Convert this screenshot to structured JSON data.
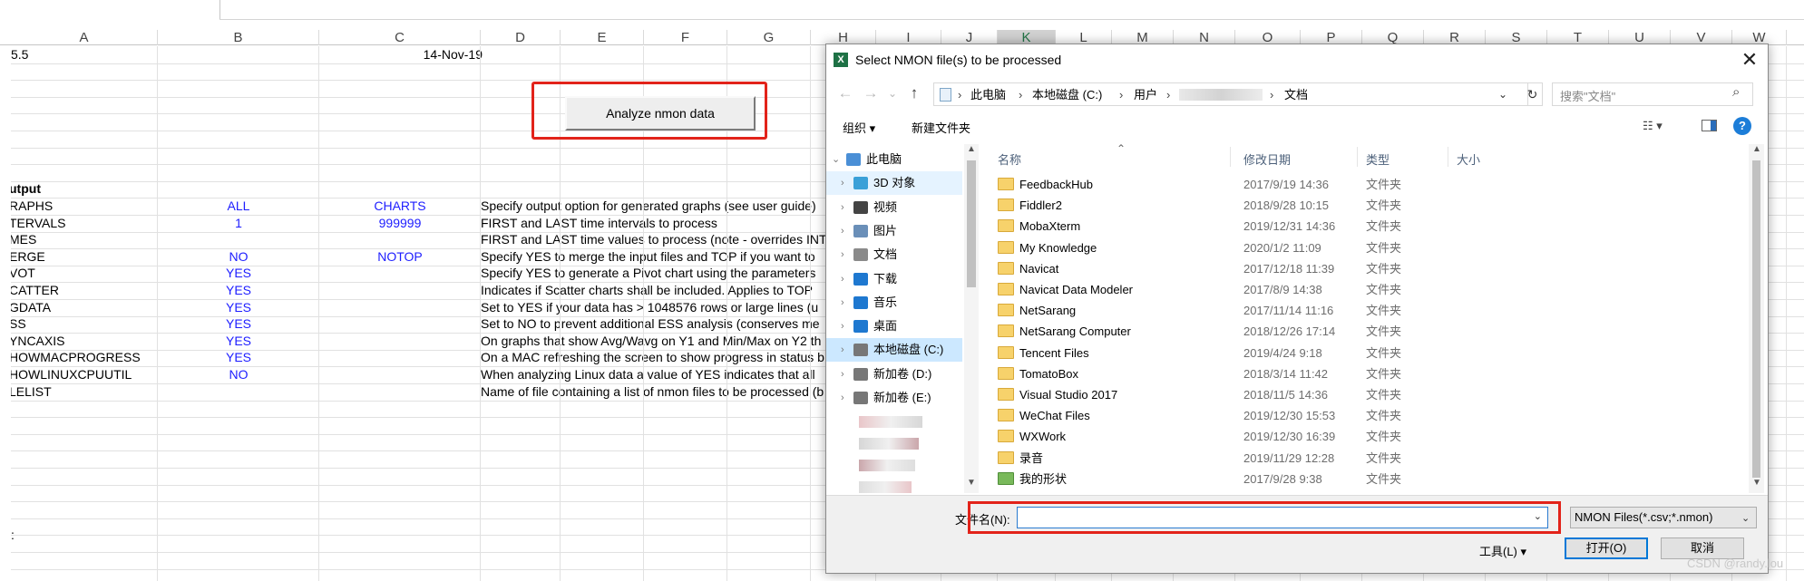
{
  "columns": [
    "A",
    "B",
    "C",
    "D",
    "E",
    "F",
    "G",
    "H",
    "I",
    "J",
    "K",
    "L",
    "M",
    "N",
    "O",
    "P",
    "Q",
    "R",
    "S",
    "T",
    "U",
    "V",
    "W"
  ],
  "active_column": "K",
  "sheet": {
    "row1": {
      "a": "5.5",
      "c": "14-Nov-19"
    },
    "section_label": "utput",
    "rows": [
      {
        "a": "RAPHS",
        "b": "ALL",
        "c": "CHARTS",
        "d": "Specify output option for generated graphs (see user guide)"
      },
      {
        "a": "TERVALS",
        "b": "1",
        "c": "999999",
        "d": "FIRST and LAST time intervals to process"
      },
      {
        "a": "MES",
        "b": "",
        "c": "",
        "d": "FIRST and LAST time values to process (note - overrides INT"
      },
      {
        "a": "ERGE",
        "b": "NO",
        "c": "NOTOP",
        "d": "Specify YES to merge the input files and TOP if you want to"
      },
      {
        "a": "VOT",
        "b": "YES",
        "c": "",
        "d": "Specify YES to generate a Pivot chart using the parameters"
      },
      {
        "a": "CATTER",
        "b": "YES",
        "c": "",
        "d": "Indicates if Scatter charts shall be included.  Applies to TOP"
      },
      {
        "a": "GDATA",
        "b": "YES",
        "c": "",
        "d": "Set to YES if your data has > 1048576 rows or large lines (u"
      },
      {
        "a": "SS",
        "b": "YES",
        "c": "",
        "d": "Set to NO to prevent additional ESS analysis (conserves me"
      },
      {
        "a": "YNCAXIS",
        "b": "YES",
        "c": "",
        "d": "On graphs that show Avg/Wavg on Y1 and Min/Max on Y2 th"
      },
      {
        "a": "HOWMACPROGRESS",
        "b": "YES",
        "c": "",
        "d": "On a MAC refreshing the screen to show progress in status b"
      },
      {
        "a": "HOWLINUXCPUUTIL",
        "b": "NO",
        "c": "",
        "d": "When analyzing Linux data a value of YES indicates that all"
      },
      {
        "a": "LELIST",
        "b": "",
        "c": "",
        "d": "Name of file containing a list of nmon files to be processed (b"
      }
    ],
    "stray_char": ":"
  },
  "analyze_button": {
    "label": "Analyze nmon data"
  },
  "dialog": {
    "title": "Select NMON file(s) to be processed",
    "close": "✕",
    "breadcrumbs": [
      "此电脑",
      "本地磁盘 (C:)",
      "用户",
      "文档"
    ],
    "search_placeholder": "搜索\"文档\"",
    "toolbar": {
      "organize": "组织 ▾",
      "new_folder": "新建文件夹"
    },
    "nav": [
      {
        "label": "此电脑",
        "color": "#4a8fd6",
        "root": true
      },
      {
        "label": "3D 对象",
        "color": "#3aa0d8",
        "selected": true
      },
      {
        "label": "视频",
        "color": "#444444"
      },
      {
        "label": "图片",
        "color": "#6a8fb8"
      },
      {
        "label": "文档",
        "color": "#8a8a8a"
      },
      {
        "label": "下载",
        "color": "#1e78d0"
      },
      {
        "label": "音乐",
        "color": "#1e78d0"
      },
      {
        "label": "桌面",
        "color": "#1e78d0"
      },
      {
        "label": "本地磁盘 (C:)",
        "color": "#777777",
        "selected": true
      },
      {
        "label": "新加卷 (D:)",
        "color": "#777777"
      },
      {
        "label": "新加卷 (E:)",
        "color": "#777777"
      }
    ],
    "columns": {
      "name": "名称",
      "date": "修改日期",
      "type": "类型",
      "size": "大小"
    },
    "files": [
      {
        "name": "FeedbackHub",
        "date": "2017/9/19 14:36",
        "type": "文件夹"
      },
      {
        "name": "Fiddler2",
        "date": "2018/9/28 10:15",
        "type": "文件夹"
      },
      {
        "name": "MobaXterm",
        "date": "2019/12/31 14:36",
        "type": "文件夹"
      },
      {
        "name": "My Knowledge",
        "date": "2020/1/2 11:09",
        "type": "文件夹"
      },
      {
        "name": "Navicat",
        "date": "2017/12/18 11:39",
        "type": "文件夹"
      },
      {
        "name": "Navicat Data Modeler",
        "date": "2017/8/9 14:38",
        "type": "文件夹"
      },
      {
        "name": "NetSarang",
        "date": "2017/11/14 11:16",
        "type": "文件夹"
      },
      {
        "name": "NetSarang Computer",
        "date": "2018/12/26 17:14",
        "type": "文件夹"
      },
      {
        "name": "Tencent Files",
        "date": "2019/4/24 9:18",
        "type": "文件夹"
      },
      {
        "name": "TomatoBox",
        "date": "2018/3/14 11:42",
        "type": "文件夹"
      },
      {
        "name": "Visual Studio 2017",
        "date": "2018/11/5 14:36",
        "type": "文件夹"
      },
      {
        "name": "WeChat Files",
        "date": "2019/12/30 15:53",
        "type": "文件夹"
      },
      {
        "name": "WXWork",
        "date": "2019/12/30 16:39",
        "type": "文件夹"
      },
      {
        "name": "录音",
        "date": "2019/11/29 12:28",
        "type": "文件夹"
      },
      {
        "name": "我的形状",
        "date": "2017/9/28 9:38",
        "type": "文件夹",
        "special": true
      }
    ],
    "filename_label": "文件名(N):",
    "filename_value": "",
    "filter": "NMON Files(*.csv;*.nmon)",
    "tools": "工具(L)  ▾",
    "open": "打开(O)",
    "cancel": "取消"
  },
  "watermark": "CSDN @randy.lou",
  "colors": {
    "highlight": "#e2231a",
    "excel_green": "#217346",
    "blue_text": "#1d1dff"
  }
}
